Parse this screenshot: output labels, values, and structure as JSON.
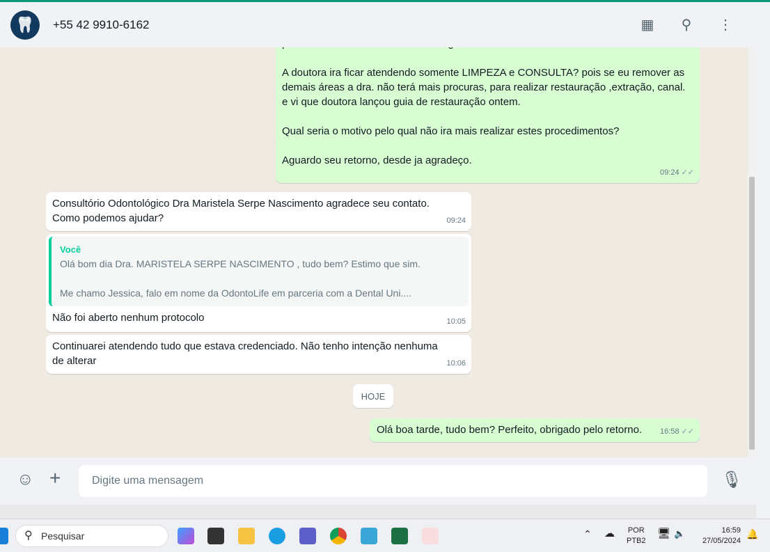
{
  "header": {
    "title": "+55 42 9910-6162",
    "icons": [
      "store-icon",
      "search-icon",
      "menu-icon"
    ]
  },
  "messages": {
    "out1": {
      "lines": [
        "para remover as demais áreas divulgadas.",
        "",
        "A doutora ira ficar atendendo somente LIMPEZA e CONSULTA? pois se eu remover as",
        "demais áreas a dra. não terá mais procuras, para realizar restauração ,extração, canal.",
        "e vi que doutora lançou guia de restauração ontem.",
        "",
        "Qual seria o motivo pelo qual não ira mais realizar estes procedimentos?",
        "",
        "Aguardo seu retorno, desde ja agradeço."
      ],
      "time": "09:24"
    },
    "in1": {
      "lines": [
        "Consultório Odontológico Dra Maristela Serpe Nascimento agradece seu contato.",
        "Como podemos ajudar?"
      ],
      "time": "09:24"
    },
    "in2": {
      "quote_author": "Você",
      "quote_lines": [
        "Olá bom dia Dra. MARISTELA SERPE NASCIMENTO , tudo bem? Estimo que sim.",
        "",
        "Me chamo Jessica, falo em nome da OdontoLife em parceria com a Dental Uni...."
      ],
      "text": "Não foi aberto nenhum protocolo",
      "time": "10:05"
    },
    "in3": {
      "lines": [
        "Continuarei atendendo tudo que estava credenciado. Não tenho intenção nenhuma",
        "de alterar"
      ],
      "time": "10:06"
    },
    "day": "HOJE",
    "out2": {
      "text": "Olá boa tarde, tudo bem? Perfeito, obrigado pelo retorno.",
      "time": "16:58"
    }
  },
  "footer": {
    "placeholder": "Digite uma mensagem"
  },
  "taskbar": {
    "search": "Pesquisar",
    "lang1": "POR",
    "lang2": "PTB2",
    "time": "16:59",
    "date": "27/05/2024"
  }
}
